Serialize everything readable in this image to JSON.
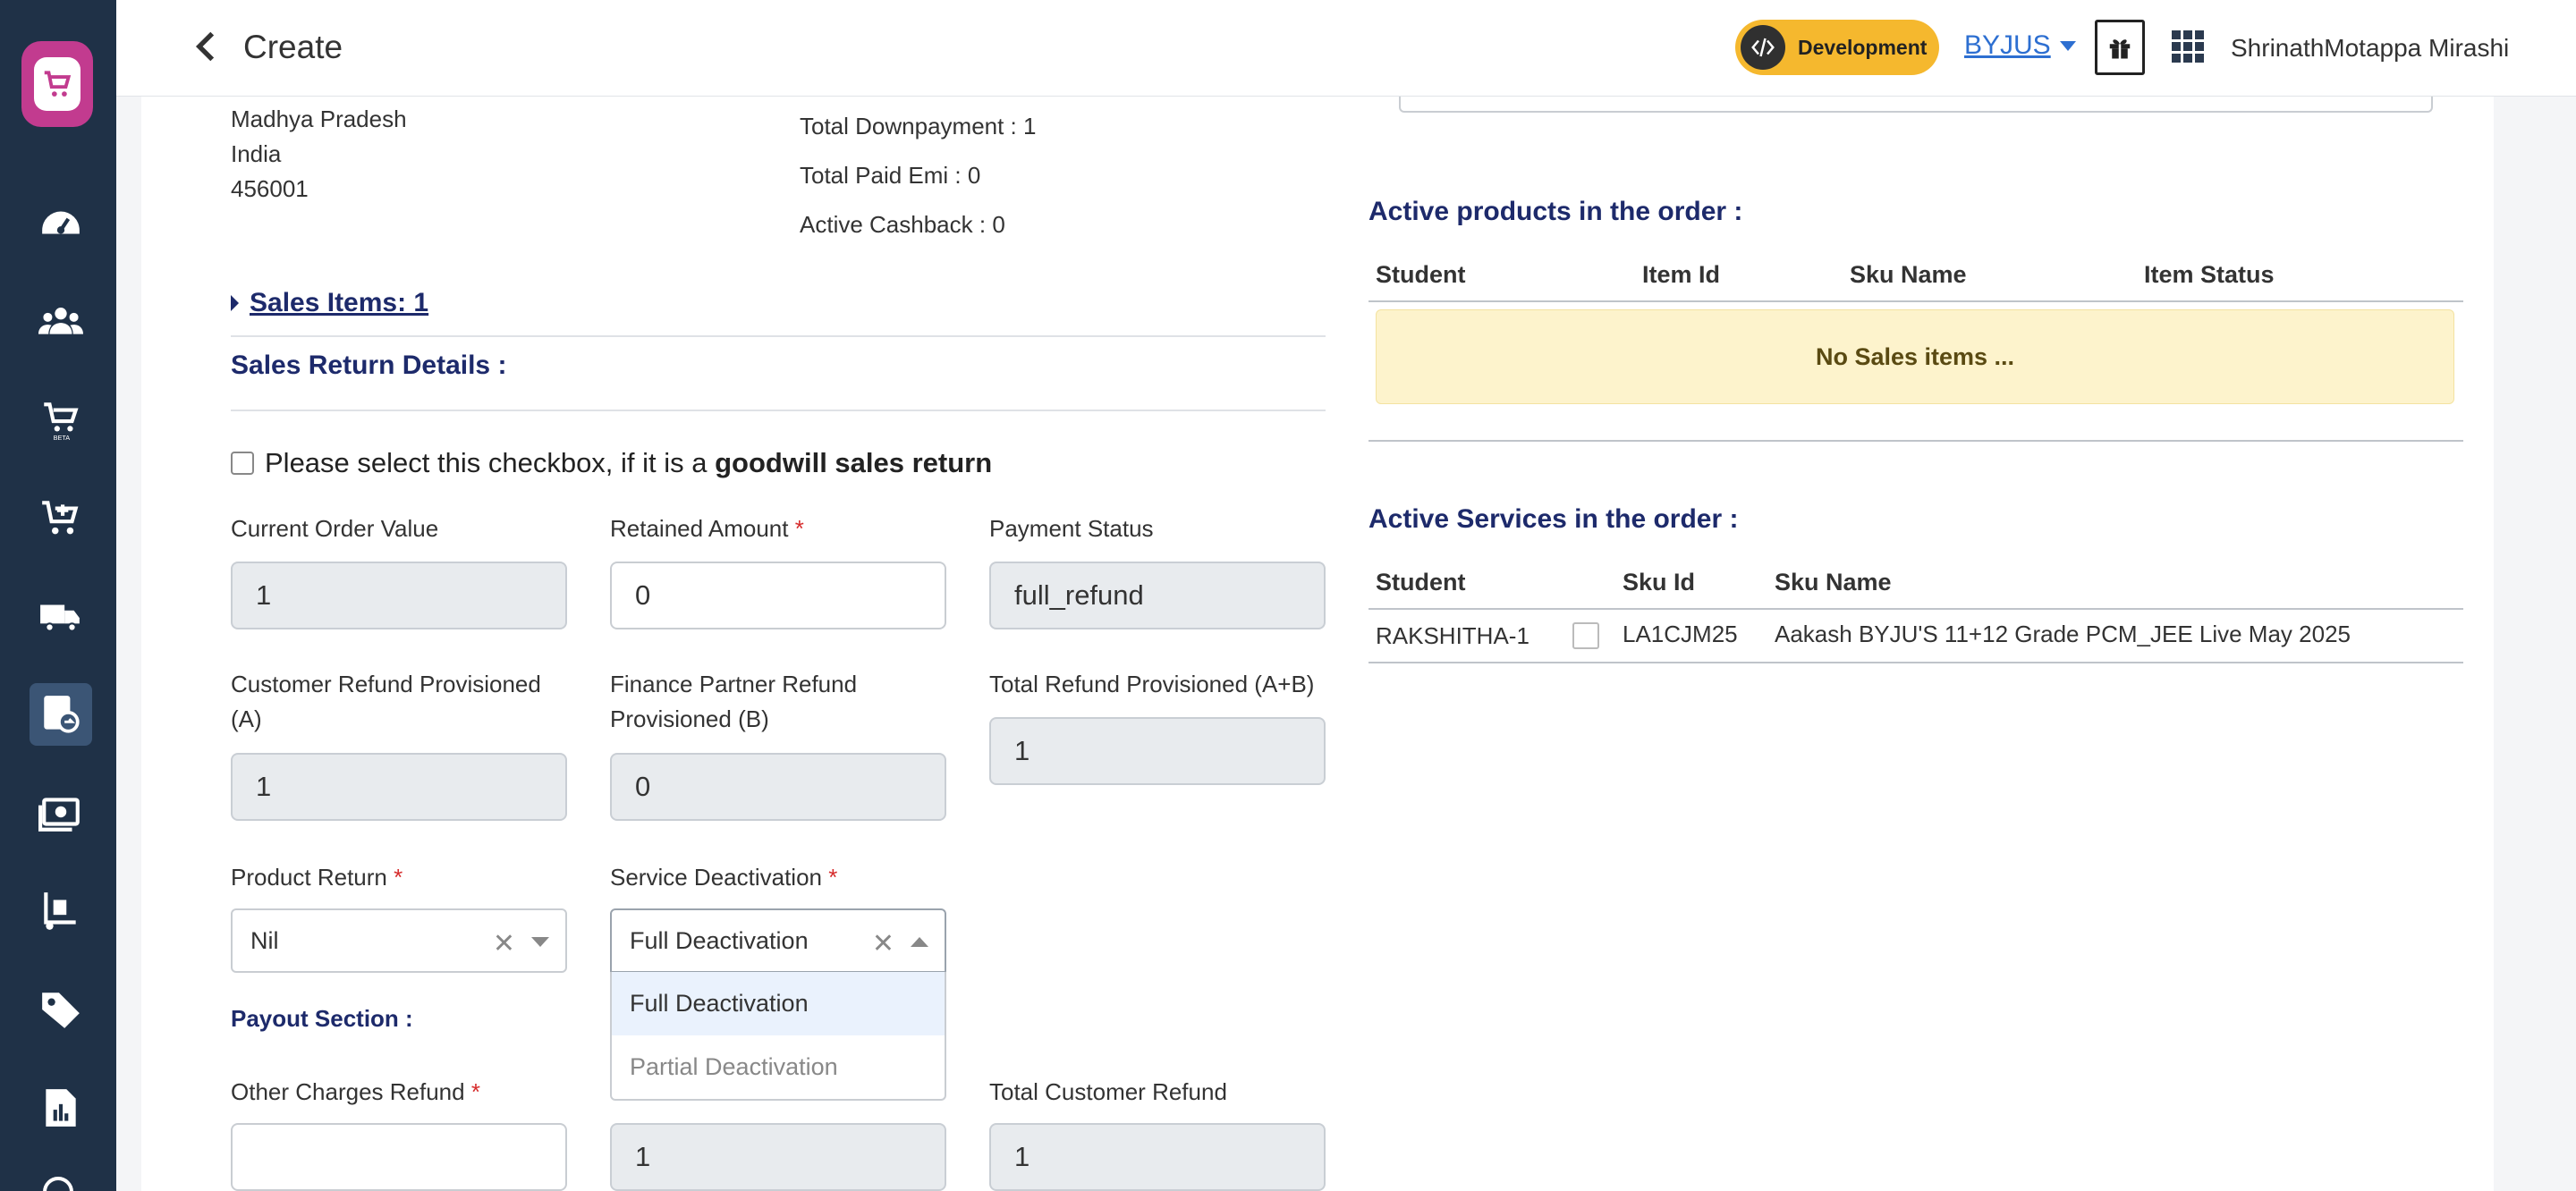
{
  "header": {
    "title": "Create",
    "env_badge": "Development",
    "org": "BYJUS",
    "user_name": "ShrinathMotappa Mirashi"
  },
  "sidebar": {
    "items": [
      {
        "icon": "dashboard-icon"
      },
      {
        "icon": "users-icon"
      },
      {
        "icon": "beta-products-icon"
      },
      {
        "icon": "add-to-cart-icon"
      },
      {
        "icon": "delivery-truck-icon"
      },
      {
        "icon": "sales-return-icon"
      },
      {
        "icon": "payments-icon"
      },
      {
        "icon": "inventory-icon"
      },
      {
        "icon": "tag-icon"
      },
      {
        "icon": "reports-icon"
      }
    ]
  },
  "address": {
    "state": "Madhya Pradesh",
    "country": "India",
    "pincode": "456001"
  },
  "order_stats": {
    "downpayment": "Total Downpayment : 1",
    "paid_emi": "Total Paid Emi : 0",
    "cashback": "Active Cashback : 0"
  },
  "sales_items_link": "Sales Items: 1",
  "sales_return": {
    "title": "Sales Return Details :",
    "goodwill_text": "Please select this checkbox, if it is a ",
    "goodwill_bold": "goodwill sales return",
    "fields": {
      "current_order_value": {
        "label": "Current Order Value",
        "value": "1"
      },
      "retained_amount": {
        "label": "Retained Amount",
        "value": "0"
      },
      "payment_status": {
        "label": "Payment Status",
        "value": "full_refund"
      },
      "customer_refund": {
        "label": "Customer Refund Provisioned (A)",
        "value": "1"
      },
      "finance_partner_refund": {
        "label": "Finance Partner Refund Provisioned (B)",
        "value": "0"
      },
      "total_refund": {
        "label": "Total Refund Provisioned (A+B)",
        "value": "1"
      },
      "product_return": {
        "label": "Product Return",
        "value": "Nil"
      },
      "service_deactivation": {
        "label": "Service Deactivation",
        "value": "Full Deactivation",
        "options": [
          "Full Deactivation",
          "Partial Deactivation"
        ]
      }
    },
    "payout_title": "Payout Section :",
    "other_charges_refund": {
      "label": "Other Charges Refund",
      "value": ""
    },
    "mid_payout_value": "1",
    "total_customer_refund": {
      "label": "Total Customer Refund",
      "value": "1"
    },
    "required_mark": "*"
  },
  "active_products": {
    "title": "Active products in the order :",
    "columns": [
      "Student",
      "Item Id",
      "Sku Name",
      "Item Status"
    ],
    "empty_text": "No Sales items ..."
  },
  "active_services": {
    "title": "Active Services in the order :",
    "columns": [
      "Student",
      "Sku Id",
      "Sku Name"
    ],
    "rows": [
      {
        "student": "RAKSHITHA-1",
        "sku_id": "LA1CJM25",
        "sku_name": "Aakash BYJU'S 11+12 Grade PCM_JEE Live May 2025"
      }
    ]
  }
}
